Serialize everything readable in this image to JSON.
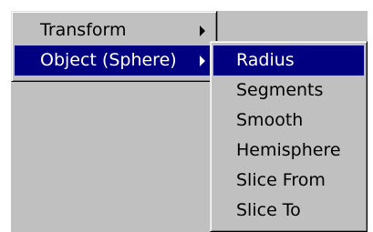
{
  "colors": {
    "menu_face": "#c0c0c0",
    "highlight": "#000080",
    "highlight_text": "#ffffff",
    "text": "#000000"
  },
  "main_menu": {
    "items": [
      {
        "label": "Transform",
        "has_submenu": true,
        "selected": false,
        "icon": "chevron-right-icon"
      },
      {
        "label": "Object (Sphere)",
        "has_submenu": true,
        "selected": true,
        "icon": "chevron-right-icon"
      }
    ]
  },
  "submenu": {
    "items": [
      {
        "label": "Radius",
        "selected": true
      },
      {
        "label": "Segments",
        "selected": false
      },
      {
        "label": "Smooth",
        "selected": false
      },
      {
        "label": "Hemisphere",
        "selected": false
      },
      {
        "label": "Slice From",
        "selected": false
      },
      {
        "label": "Slice To",
        "selected": false
      }
    ]
  }
}
